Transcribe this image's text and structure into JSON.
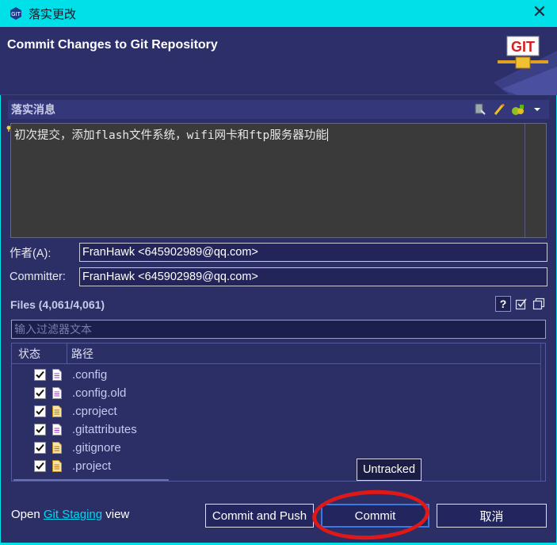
{
  "window": {
    "title": "落实更改",
    "close_label": "✕"
  },
  "banner": {
    "heading": "Commit Changes to Git Repository",
    "logo_text": "GIT"
  },
  "message_section": {
    "label": "落实消息",
    "text": "初次提交，添加flash文件系统，wifi网卡和ftp服务器功能"
  },
  "author": {
    "label": "作者(A):",
    "value": "FranHawk <645902989@qq.com>"
  },
  "committer": {
    "label": "Committer:",
    "value": "FranHawk <645902989@qq.com>"
  },
  "files_section": {
    "label": "Files (4,061/4,061)",
    "help_label": "?",
    "filter_placeholder": "输入过滤器文本",
    "columns": [
      "状态",
      "路径"
    ],
    "rows": [
      {
        "name": ".config",
        "checked": true,
        "icon": "text-file-icon"
      },
      {
        "name": ".config.old",
        "checked": true,
        "icon": "text-file-icon"
      },
      {
        "name": ".cproject",
        "checked": true,
        "icon": "untracked-file-icon"
      },
      {
        "name": ".gitattributes",
        "checked": true,
        "icon": "text-file-icon"
      },
      {
        "name": ".gitignore",
        "checked": true,
        "icon": "untracked-file-icon"
      },
      {
        "name": ".project",
        "checked": true,
        "icon": "untracked-file-icon"
      }
    ]
  },
  "tooltip": "Untracked",
  "footer": {
    "prefix": "Open ",
    "link": "Git Staging",
    "suffix": " view"
  },
  "buttons": {
    "commit_and_push": "Commit and Push",
    "commit": "Commit",
    "cancel": "取消"
  },
  "colors": {
    "titlebar": "#00e0e8",
    "background": "#2b2f66",
    "link": "#00d8f0",
    "annotation": "#e01818"
  }
}
